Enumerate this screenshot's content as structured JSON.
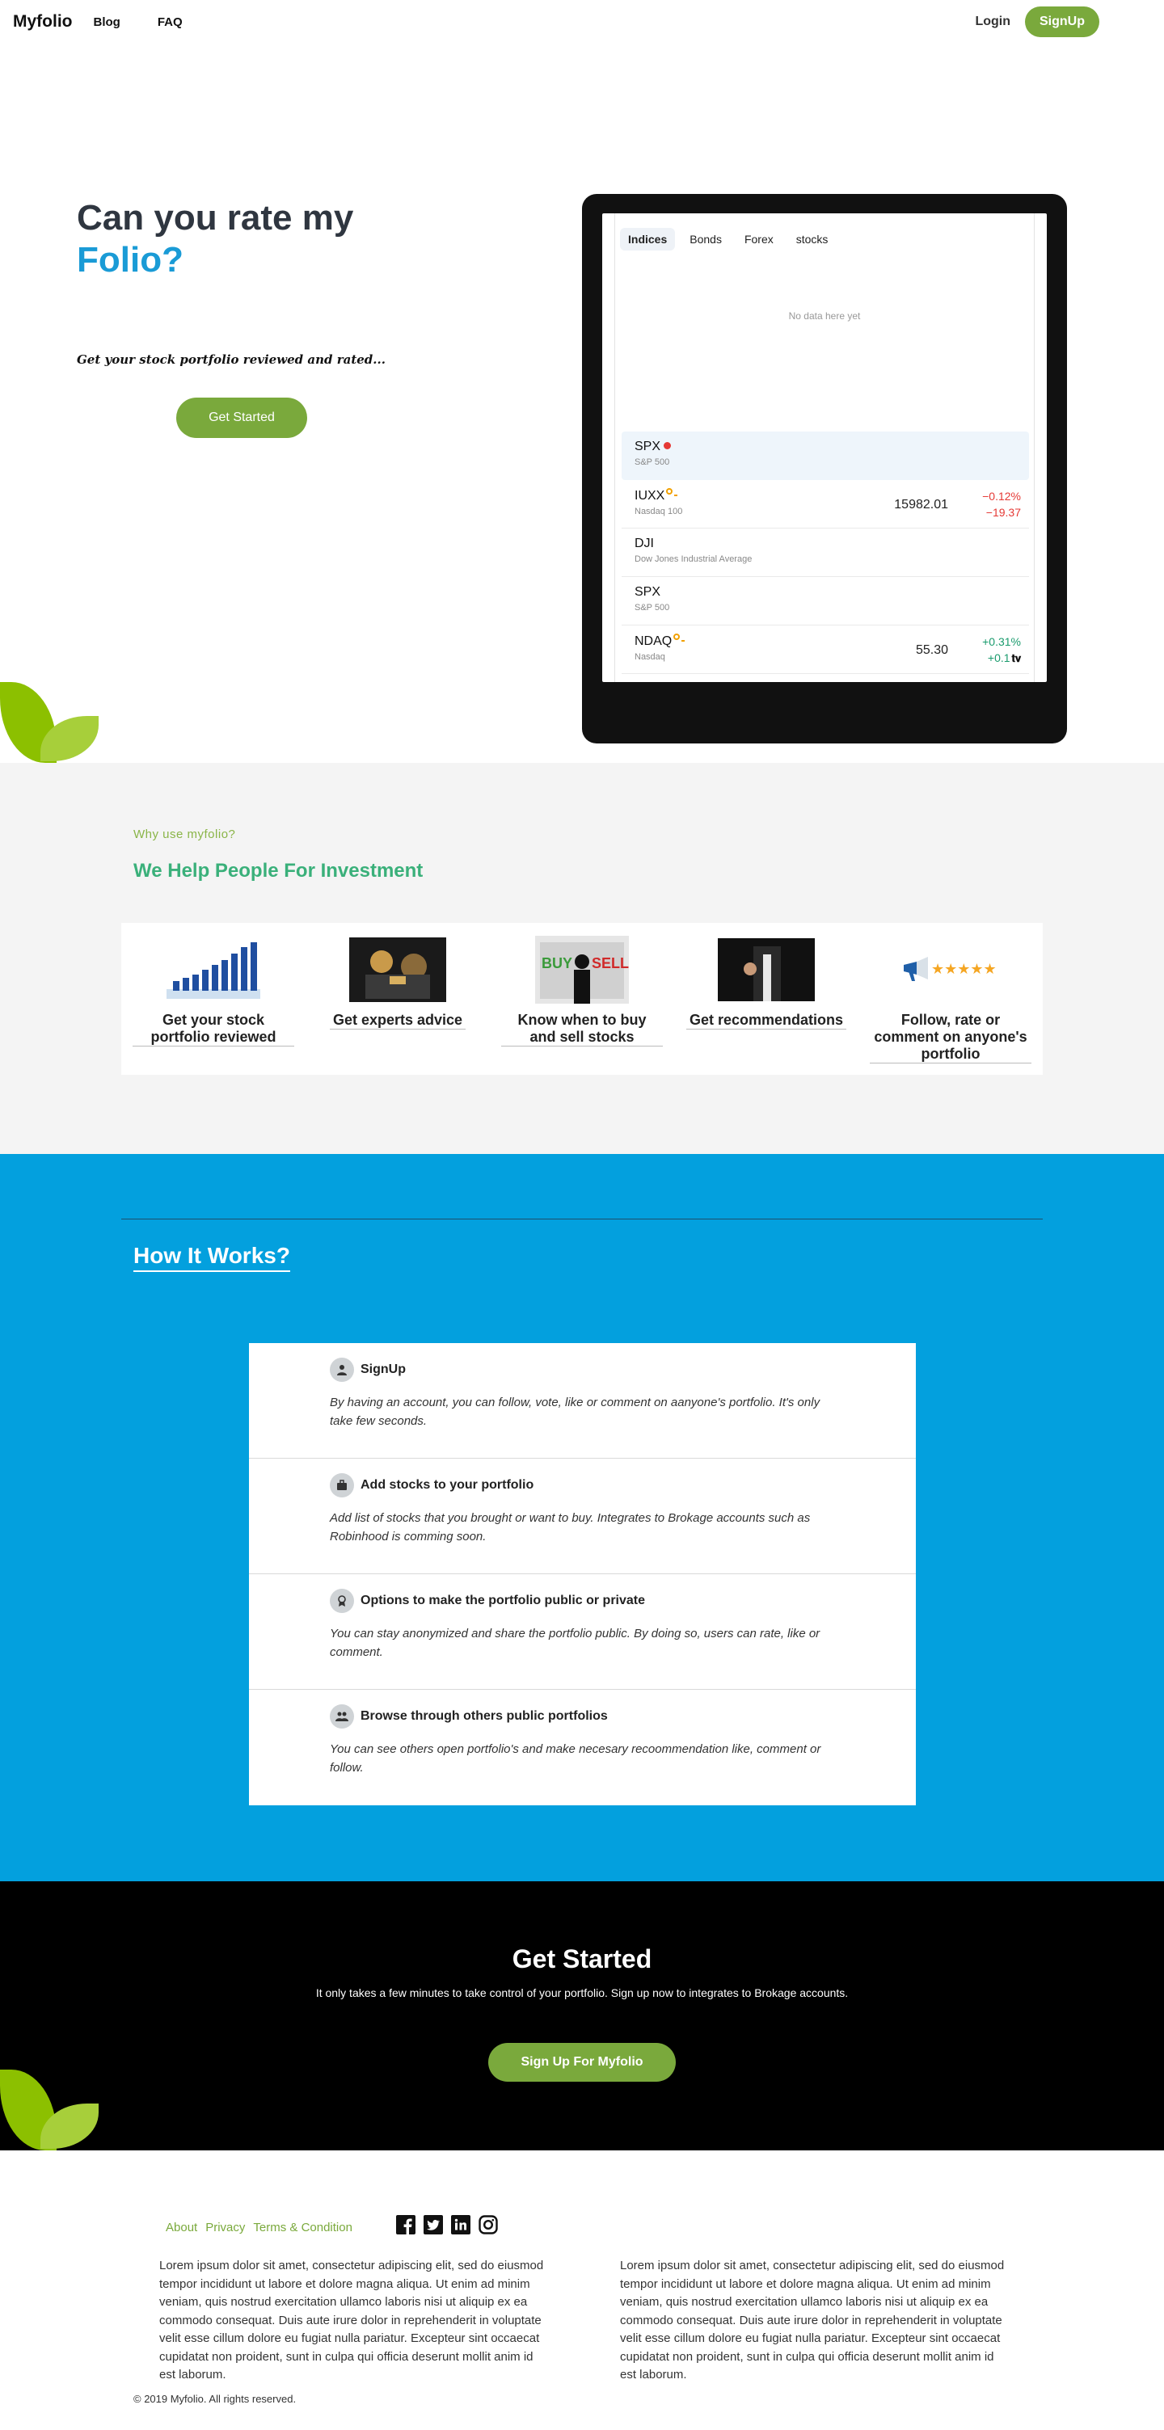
{
  "nav": {
    "brand": "Myfolio",
    "links": [
      "Blog",
      "FAQ"
    ],
    "login": "Login",
    "signup": "SignUp"
  },
  "hero": {
    "title_line1": "Can you rate my",
    "title_line2": "Folio?",
    "subtitle": "Get your stock portfolio reviewed and rated...",
    "cta": "Get Started",
    "accent_color": "#1a9bd6"
  },
  "widget": {
    "tabs": [
      "Indices",
      "Bonds",
      "Forex",
      "stocks"
    ],
    "active_tab": "Indices",
    "empty_message": "No data here yet",
    "rows": [
      {
        "symbol": "SPX",
        "name": "S&P 500",
        "price": "",
        "change_pct": "",
        "change_abs": ""
      },
      {
        "symbol": "IUXX",
        "name": "Nasdaq 100",
        "price": "15982.01",
        "change_pct": "−0.12%",
        "change_abs": "−19.37"
      },
      {
        "symbol": "DJI",
        "name": "Dow Jones Industrial Average",
        "price": "",
        "change_pct": "",
        "change_abs": ""
      },
      {
        "symbol": "SPX",
        "name": "S&P 500",
        "price": "",
        "change_pct": "",
        "change_abs": ""
      },
      {
        "symbol": "NDAQ",
        "name": "Nasdaq",
        "price": "55.30",
        "change_pct": "+0.31%",
        "change_abs": "+0.1"
      }
    ],
    "negative_color": "#e53935",
    "positive_color": "#1a9b6d"
  },
  "why": {
    "eyebrow": "Why use myfolio?",
    "title": "We Help People For Investment",
    "features": [
      {
        "title": "Get your stock portfolio reviewed",
        "icon": "bar-chart-image"
      },
      {
        "title": "Get experts advice",
        "icon": "experts-photo"
      },
      {
        "title": "Know when to buy and sell stocks",
        "icon": "buy-sell-photo"
      },
      {
        "title": "Get recommendations",
        "icon": "thumbs-up-photo"
      },
      {
        "title": "Follow, rate or comment on anyone's portfolio",
        "icon": "megaphone-stars-image"
      }
    ]
  },
  "how": {
    "title": "How It Works?",
    "steps": [
      {
        "title": "SignUp",
        "icon": "user-icon",
        "text": "By having an account, you can follow, vote, like or comment on aanyone's portfolio. It's only take few seconds."
      },
      {
        "title": "Add stocks to your portfolio",
        "icon": "briefcase-icon",
        "text": "Add list of stocks that you brought or want to buy. Integrates to Brokage accounts such as Robinhood is comming soon."
      },
      {
        "title": "Options to make the portfolio public or private",
        "icon": "award-icon",
        "text": "You can stay anonymized and share the portfolio public. By doing so, users can rate, like or comment."
      },
      {
        "title": "Browse through others public portfolios",
        "icon": "users-icon",
        "text": "You can see others open portfolio's and make necesary recoommendation like, comment or follow."
      }
    ]
  },
  "cta": {
    "title": "Get Started",
    "text": "It only takes a few minutes to take control of your portfolio. Sign up now to integrates to Brokage accounts.",
    "button": "Sign Up For Myfolio"
  },
  "footer": {
    "links": [
      "About",
      "Privacy",
      "Terms & Condition"
    ],
    "social": [
      "facebook-icon",
      "twitter-icon",
      "linkedin-icon",
      "instagram-icon"
    ],
    "text_left": "Lorem ipsum dolor sit amet, consectetur adipiscing elit, sed do eiusmod tempor incididunt ut labore et dolore magna aliqua. Ut enim ad minim veniam, quis nostrud exercitation ullamco laboris nisi ut aliquip ex ea commodo consequat. Duis aute irure dolor in reprehenderit in voluptate velit esse cillum dolore eu fugiat nulla pariatur. Excepteur sint occaecat cupidatat non proident, sunt in culpa qui officia deserunt mollit anim id est laborum.",
    "text_right": "Lorem ipsum dolor sit amet, consectetur adipiscing elit, sed do eiusmod tempor incididunt ut labore et dolore magna aliqua. Ut enim ad minim veniam, quis nostrud exercitation ullamco laboris nisi ut aliquip ex ea commodo consequat. Duis aute irure dolor in reprehenderit in voluptate velit esse cillum dolore eu fugiat nulla pariatur. Excepteur sint occaecat cupidatat non proident, sunt in culpa qui officia deserunt mollit anim id est laborum.",
    "copyright": "© 2019 Myfolio. All rights reserved."
  }
}
